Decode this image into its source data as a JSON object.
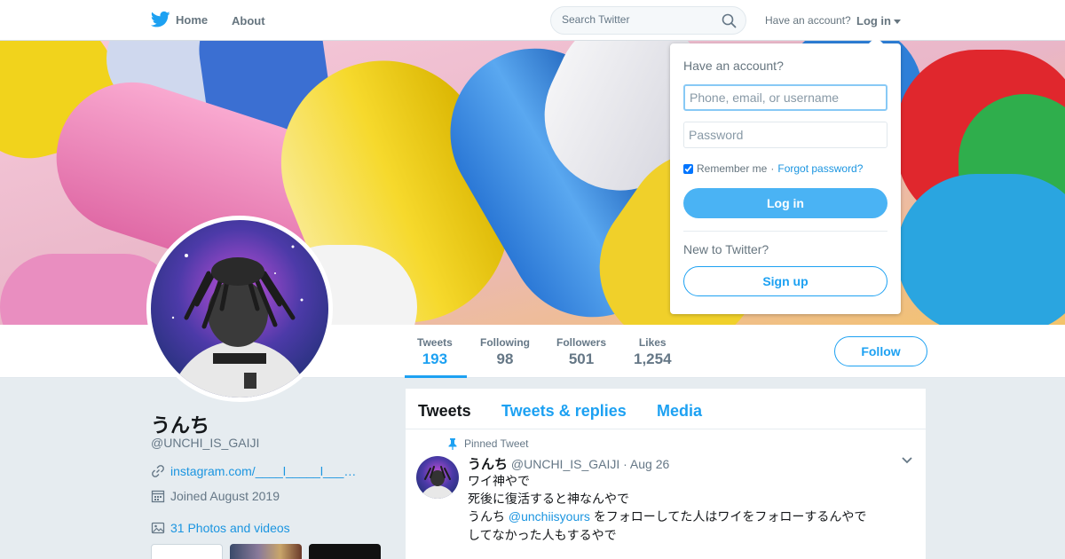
{
  "nav": {
    "home_label": "Home",
    "about_label": "About",
    "search_placeholder": "Search Twitter",
    "have_account": "Have an account?",
    "login_label": "Log in"
  },
  "profile": {
    "name": "うんち",
    "handle": "@UNCHI_IS_GAIJI",
    "link": "instagram.com/____l_____l___…",
    "joined": "Joined August 2019",
    "photos_videos": "31 Photos and videos"
  },
  "stats": [
    {
      "label": "Tweets",
      "value": "193",
      "active": true
    },
    {
      "label": "Following",
      "value": "98",
      "active": false
    },
    {
      "label": "Followers",
      "value": "501",
      "active": false
    },
    {
      "label": "Likes",
      "value": "1,254",
      "active": false
    }
  ],
  "follow_label": "Follow",
  "timeline": {
    "tabs": [
      "Tweets",
      "Tweets & replies",
      "Media"
    ],
    "pinned_label": "Pinned Tweet",
    "tweet": {
      "name": "うんち",
      "handle": "@UNCHI_IS_GAIJI",
      "date": "· Aug 26",
      "line1": "ワイ神やで",
      "line2": "死後に復活すると神なんやで",
      "line3_prefix": "うんち",
      "line3_mention": "@unchiisyours",
      "line3_suffix": "をフォローしてた人はワイをフォローするんやで",
      "line4": "してなかった人もするやで"
    }
  },
  "login_dropdown": {
    "title": "Have an account?",
    "username_placeholder": "Phone, email, or username",
    "password_placeholder": "Password",
    "remember_label": "Remember me",
    "separator": "·",
    "forgot_label": "Forgot password?",
    "login_button": "Log in",
    "new_label": "New to Twitter?",
    "signup_button": "Sign up"
  },
  "colors": {
    "accent": "#1da1f2",
    "background": "#e6ecf0"
  }
}
